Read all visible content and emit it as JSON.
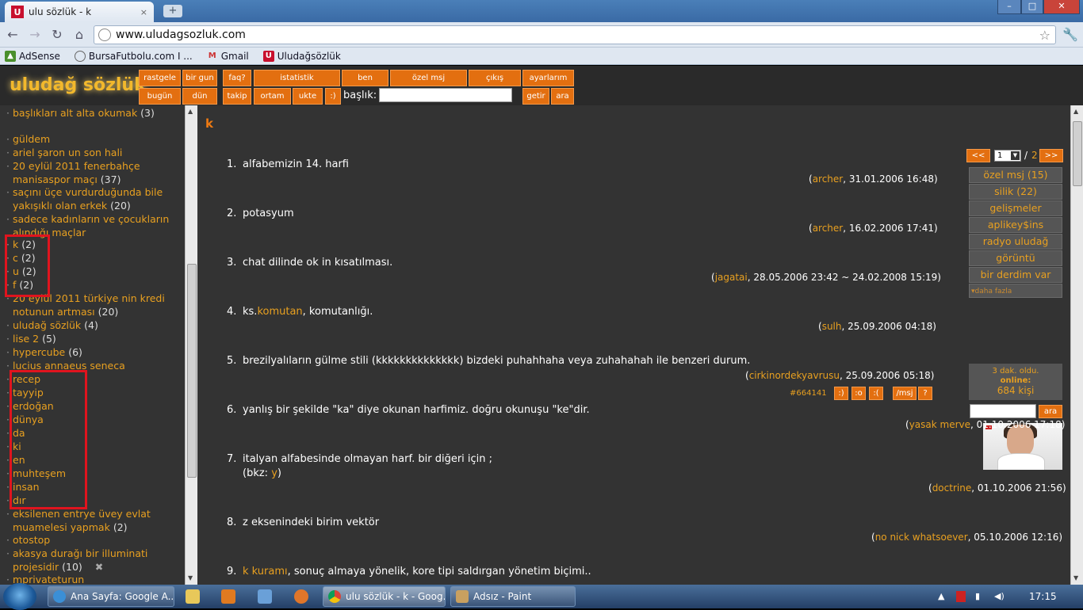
{
  "browser": {
    "tab_title": "ulu sözlük - k",
    "tab_close": "×",
    "new_tab": "+",
    "url": "www.uludagsozluk.com",
    "win_min": "–",
    "win_max": "□",
    "win_close": "✕",
    "back": "←",
    "forward": "→",
    "reload": "↻",
    "home": "⌂",
    "star": "☆",
    "wrench": "🔧",
    "bookmarks": [
      {
        "label": "AdSense"
      },
      {
        "label": "BursaFutbolu.com I ..."
      },
      {
        "label": "Gmail"
      },
      {
        "label": "Uludağsözlük"
      }
    ]
  },
  "site": {
    "logo": "uludağ sözlük",
    "menu_row1": [
      "rastgele",
      "bir gun",
      "faq?",
      "istatistik",
      "ben",
      "özel msj",
      "çıkış",
      "ayarlarım"
    ],
    "menu_row2": [
      "bugün",
      "dün",
      "takip",
      "ortam",
      "ukte",
      ":)"
    ],
    "baslik_label": "başlık:",
    "getir": "getir",
    "ara": "ara"
  },
  "left_list": [
    {
      "text": "başlıkları alt alta okumak",
      "count": "(3)"
    },
    {
      "text": "güldem",
      "count": ""
    },
    {
      "text": "ariel şaron un son hali",
      "count": ""
    },
    {
      "text": "20 eylül 2011 fenerbahçe manisaspor maçı",
      "count": "(37)"
    },
    {
      "text": "saçını üçe vurdurduğunda bile yakışıklı olan erkek",
      "count": "(20)"
    },
    {
      "text": "sadece kadınların ve çocukların alındığı maçlar",
      "count": ""
    },
    {
      "text": "k",
      "count": "(2)"
    },
    {
      "text": "c",
      "count": "(2)"
    },
    {
      "text": "u",
      "count": "(2)"
    },
    {
      "text": "f",
      "count": "(2)"
    },
    {
      "text": "20 eylül 2011 türkiye nin kredi notunun artması",
      "count": "(20)"
    },
    {
      "text": "uludağ sözlük",
      "count": "(4)"
    },
    {
      "text": "lise 2",
      "count": "(5)"
    },
    {
      "text": "hypercube",
      "count": "(6)"
    },
    {
      "text": "lucius annaeus seneca",
      "count": ""
    },
    {
      "text": "recep",
      "count": ""
    },
    {
      "text": "tayyip",
      "count": ""
    },
    {
      "text": "erdoğan",
      "count": ""
    },
    {
      "text": "dünya",
      "count": ""
    },
    {
      "text": "da",
      "count": ""
    },
    {
      "text": "ki",
      "count": ""
    },
    {
      "text": "en",
      "count": ""
    },
    {
      "text": "muhteşem",
      "count": ""
    },
    {
      "text": "insan",
      "count": ""
    },
    {
      "text": "dır",
      "count": ""
    },
    {
      "text": "eksilenen entrye üvey evlat muamelesi yapmak",
      "count": "(2)"
    },
    {
      "text": "otostop",
      "count": ""
    },
    {
      "text": "akasya durağı bir illuminati projesidir",
      "count": "(10)"
    },
    {
      "text": "mprivateturun",
      "count": ""
    }
  ],
  "main": {
    "title": "k",
    "pager": {
      "prev": "<<",
      "page": "1",
      "sep": "/",
      "total": "2",
      "next": ">>"
    },
    "entries": [
      {
        "n": "1.",
        "pre": "alfabemizin 14. harfi",
        "link": "",
        "post": "",
        "line2": "",
        "nick": "archer",
        "date": ", 31.01.2006 16:48)"
      },
      {
        "n": "2.",
        "pre": "potasyum",
        "link": "",
        "post": "",
        "line2": "",
        "nick": "archer",
        "date": ", 16.02.2006 17:41)"
      },
      {
        "n": "3.",
        "pre": "chat dilinde ok in kısatılması.",
        "link": "",
        "post": "",
        "line2": "",
        "nick": "jagatai",
        "date": ", 28.05.2006 23:42 ~ 24.02.2008 15:19)"
      },
      {
        "n": "4.",
        "pre": "ks.",
        "link": "komutan",
        "post": ", komutanlığı.",
        "line2": "",
        "nick": "sulh",
        "date": ", 25.09.2006 04:18)"
      },
      {
        "n": "5.",
        "pre": "brezilyalıların gülme stili (kkkkkkkkkkkkkk) bizdeki puhahhaha veya zuhahahah ile benzeri durum.",
        "link": "",
        "post": "",
        "line2": "",
        "nick": "cirkinordekyavrusu",
        "date": ", 25.09.2006 05:18)"
      },
      {
        "n": "6.",
        "pre": "yanlış bir şekilde \"ka\" diye okunan harfimiz. doğru okunuşu \"ke\"dir.",
        "link": "",
        "post": "",
        "line2": "",
        "nick": "yasak merve",
        "date": ", 01.10.2006 17:18)"
      },
      {
        "n": "7.",
        "pre": "italyan alfabesinde olmayan harf. bir diğeri için ;",
        "link": "",
        "post": "",
        "line2": "(bkz: ",
        "line2link": "y",
        "line2post": ")",
        "nick": "doctrine",
        "date": ", 01.10.2006 21:56)"
      },
      {
        "n": "8.",
        "pre": "z eksenindeki birim vektör",
        "link": "",
        "post": "",
        "line2": "",
        "nick": "no nick whatsoever",
        "date": ", 05.10.2006 12:16)"
      },
      {
        "n": "9.",
        "pre": "",
        "link": "k kuramı",
        "post": ", sonuç almaya yönelik, kore tipi saldırgan yönetim biçimi..",
        "line2": "",
        "nick": "",
        "date": ""
      }
    ],
    "entry_tools": {
      "id": "#664141",
      "b1": ":)",
      "b2": ":o",
      "b3": ":(",
      "b4": "/msj",
      "b5": "?"
    },
    "open_paren": "("
  },
  "sidebar": {
    "buttons": [
      "özel msj (15)",
      "silik (22)",
      "gelişmeler",
      "aplikey$ins",
      "radyo uludağ",
      "görüntü",
      "bir derdim var"
    ],
    "more": "▾daha fazla",
    "online_line1": "3 dak. oldu.",
    "online_line2": "online:",
    "online_line3": "684 kişi",
    "search_btn": "ara"
  },
  "taskbar": {
    "items": [
      "Ana Sayfa: Google A...",
      "ulu sözlük - k - Goog...",
      "Adsız - Paint"
    ],
    "clock": "17:15"
  }
}
